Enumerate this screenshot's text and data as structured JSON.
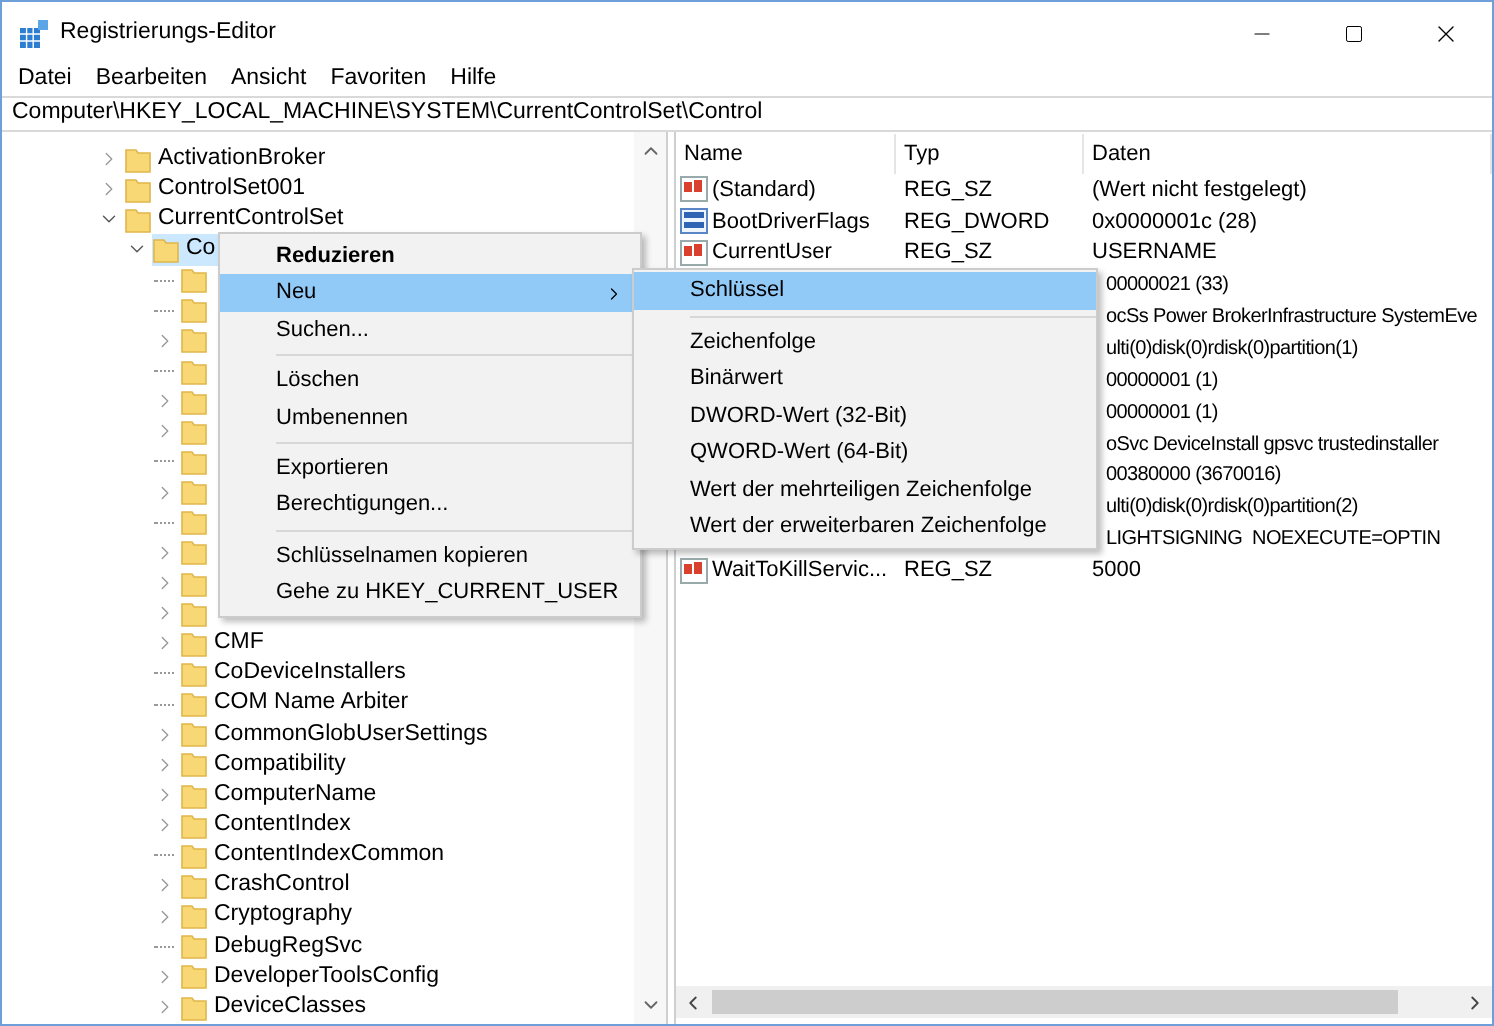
{
  "window": {
    "title": "Registrierungs-Editor"
  },
  "menu_bar": [
    "Datei",
    "Bearbeiten",
    "Ansicht",
    "Favoriten",
    "Hilfe"
  ],
  "address": "Computer\\HKEY_LOCAL_MACHINE\\SYSTEM\\CurrentControlSet\\Control",
  "tree": [
    {
      "label": "ActivationBroker",
      "expandable": true,
      "expanded": false,
      "selected": false
    },
    {
      "label": "ControlSet001",
      "expandable": true,
      "expanded": false,
      "selected": false
    },
    {
      "label": "CurrentControlSet",
      "expandable": true,
      "expanded": true,
      "selected": false,
      "children": [
        {
          "label": "Co",
          "expandable": true,
          "expanded": true,
          "selected": true,
          "children": [
            {
              "expandable": false
            },
            {
              "expandable": false
            },
            {
              "expandable": true
            },
            {
              "expandable": false
            },
            {
              "expandable": true
            },
            {
              "expandable": true
            },
            {
              "expandable": false
            },
            {
              "expandable": true
            },
            {
              "expandable": false
            },
            {
              "expandable": true
            },
            {
              "expandable": true
            },
            {
              "expandable": true
            },
            {
              "label": "CMF",
              "expandable": true
            },
            {
              "label": "CoDeviceInstallers",
              "expandable": false
            },
            {
              "label": "COM Name Arbiter",
              "expandable": false
            },
            {
              "label": "CommonGlobUserSettings",
              "expandable": true
            },
            {
              "label": "Compatibility",
              "expandable": true
            },
            {
              "label": "ComputerName",
              "expandable": true
            },
            {
              "label": "ContentIndex",
              "expandable": true
            },
            {
              "label": "ContentIndexCommon",
              "expandable": false
            },
            {
              "label": "CrashControl",
              "expandable": true
            },
            {
              "label": "Cryptography",
              "expandable": true
            },
            {
              "label": "DebugRegSvc",
              "expandable": false
            },
            {
              "label": "DeveloperToolsConfig",
              "expandable": true
            },
            {
              "label": "DeviceClasses",
              "expandable": true
            }
          ]
        }
      ]
    }
  ],
  "values": {
    "columns": [
      "Name",
      "Typ",
      "Daten"
    ],
    "rows": [
      {
        "kind": "string",
        "name": "(Standard)",
        "type": "REG_SZ",
        "data": "(Wert nicht festgelegt)"
      },
      {
        "kind": "binary",
        "name": "BootDriverFlags",
        "type": "REG_DWORD",
        "data": "0x0000001c (28)"
      },
      {
        "kind": "string",
        "name": "CurrentUser",
        "type": "REG_SZ",
        "data": "USERNAME"
      },
      {
        "kind": "partial",
        "data": "00000021 (33)"
      },
      {
        "kind": "partial",
        "data": "ocSs Power BrokerInfrastructure SystemEve"
      },
      {
        "kind": "partial",
        "data": "ulti(0)disk(0)rdisk(0)partition(1)"
      },
      {
        "kind": "partial",
        "data": "00000001 (1)"
      },
      {
        "kind": "partial",
        "data": "00000001 (1)"
      },
      {
        "kind": "partial",
        "data": "oSvc DeviceInstall gpsvc trustedinstaller"
      },
      {
        "kind": "partial",
        "data": "00380000 (3670016)"
      },
      {
        "kind": "partial",
        "data": "ulti(0)disk(0)rdisk(0)partition(2)"
      },
      {
        "kind": "partial",
        "data": "LIGHTSIGNING  NOEXECUTE=OPTIN"
      },
      {
        "kind": "string",
        "name": "WaitToKillServic...",
        "type": "REG_SZ",
        "data": "5000"
      }
    ]
  },
  "context_menu": {
    "groups": [
      [
        {
          "label": "Reduzieren",
          "default": true,
          "selected": false,
          "submenu": false
        },
        {
          "label": "Neu",
          "default": false,
          "selected": true,
          "submenu": true
        },
        {
          "label": "Suchen...",
          "default": false,
          "selected": false,
          "submenu": false
        }
      ],
      [
        {
          "label": "Löschen",
          "default": false,
          "selected": false,
          "submenu": false
        },
        {
          "label": "Umbenennen",
          "default": false,
          "selected": false,
          "submenu": false
        }
      ],
      [
        {
          "label": "Exportieren",
          "default": false,
          "selected": false,
          "submenu": false
        },
        {
          "label": "Berechtigungen...",
          "default": false,
          "selected": false,
          "submenu": false
        }
      ],
      [
        {
          "label": "Schlüsselnamen kopieren",
          "default": false,
          "selected": false,
          "submenu": false
        },
        {
          "label": "Gehe zu HKEY_CURRENT_USER",
          "default": false,
          "selected": false,
          "submenu": false
        }
      ]
    ]
  },
  "submenu": {
    "groups": [
      [
        {
          "label": "Schlüssel",
          "selected": true
        }
      ],
      [
        {
          "label": "Zeichenfolge",
          "selected": false
        },
        {
          "label": "Binärwert",
          "selected": false
        },
        {
          "label": "DWORD-Wert (32-Bit)",
          "selected": false
        },
        {
          "label": "QWORD-Wert (64-Bit)",
          "selected": false
        },
        {
          "label": "Wert der mehrteiligen Zeichenfolge",
          "selected": false
        },
        {
          "label": "Wert der erweiterbaren Zeichenfolge",
          "selected": false
        }
      ]
    ]
  }
}
